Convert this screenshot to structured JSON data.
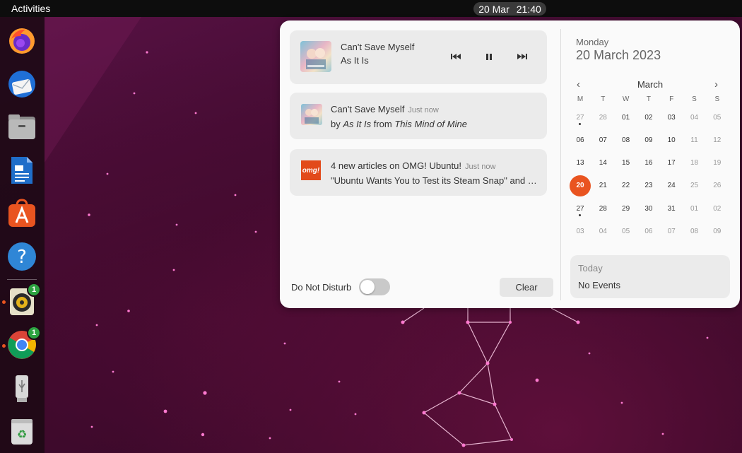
{
  "topbar": {
    "activities": "Activities",
    "clock_date": "20 Mar",
    "clock_time": "21:40"
  },
  "dock": {
    "items": [
      {
        "name": "firefox-icon"
      },
      {
        "name": "thunderbird-icon"
      },
      {
        "name": "files-icon"
      },
      {
        "name": "libreoffice-writer-icon"
      },
      {
        "name": "app-center-icon"
      },
      {
        "name": "help-icon",
        "glyph": "?"
      },
      {
        "name": "rhythmbox-icon",
        "badge": "1"
      },
      {
        "name": "chrome-icon",
        "badge": "1"
      },
      {
        "name": "usb-drive-icon"
      },
      {
        "name": "trash-icon",
        "glyph": "♻"
      }
    ]
  },
  "media": {
    "title": "Can't Save Myself",
    "artist": "As It Is",
    "controls": [
      "previous-icon",
      "pause-icon",
      "next-icon"
    ]
  },
  "notifications": [
    {
      "title": "Can't Save Myself",
      "time": "Just now",
      "body_by": "by",
      "body_artist": "As It Is",
      "body_from": "from",
      "body_album": "This Mind of Mine"
    },
    {
      "icon_label": "omg!",
      "title": "4 new articles on OMG! Ubuntu!",
      "time": "Just now",
      "body": "\"Ubuntu Wants You to Test its Steam Snap\" and …"
    }
  ],
  "dnd_label": "Do Not Disturb",
  "clear_label": "Clear",
  "calendar": {
    "day_name": "Monday",
    "full_date": "20 March 2023",
    "month": "March",
    "prev_glyph": "‹",
    "next_glyph": "›",
    "weekdays": [
      "M",
      "T",
      "W",
      "T",
      "F",
      "S",
      "S"
    ],
    "weeks": [
      [
        {
          "d": "27",
          "dim": true,
          "dot": true
        },
        {
          "d": "28",
          "dim": true
        },
        {
          "d": "01"
        },
        {
          "d": "02"
        },
        {
          "d": "03"
        },
        {
          "d": "04",
          "dim": true
        },
        {
          "d": "05",
          "dim": true
        }
      ],
      [
        {
          "d": "06"
        },
        {
          "d": "07"
        },
        {
          "d": "08"
        },
        {
          "d": "09"
        },
        {
          "d": "10"
        },
        {
          "d": "11",
          "dim": true
        },
        {
          "d": "12",
          "dim": true
        }
      ],
      [
        {
          "d": "13"
        },
        {
          "d": "14"
        },
        {
          "d": "15"
        },
        {
          "d": "16"
        },
        {
          "d": "17"
        },
        {
          "d": "18",
          "dim": true
        },
        {
          "d": "19",
          "dim": true
        }
      ],
      [
        {
          "d": "20",
          "today": true
        },
        {
          "d": "21"
        },
        {
          "d": "22"
        },
        {
          "d": "23"
        },
        {
          "d": "24"
        },
        {
          "d": "25",
          "dim": true
        },
        {
          "d": "26",
          "dim": true
        }
      ],
      [
        {
          "d": "27",
          "dot": true
        },
        {
          "d": "28"
        },
        {
          "d": "29"
        },
        {
          "d": "30"
        },
        {
          "d": "31"
        },
        {
          "d": "01",
          "dim": true
        },
        {
          "d": "02",
          "dim": true
        }
      ],
      [
        {
          "d": "03",
          "dim": true
        },
        {
          "d": "04",
          "dim": true
        },
        {
          "d": "05",
          "dim": true
        },
        {
          "d": "06",
          "dim": true
        },
        {
          "d": "07",
          "dim": true
        },
        {
          "d": "08",
          "dim": true
        },
        {
          "d": "09",
          "dim": true
        }
      ]
    ],
    "accent": "#e95420"
  },
  "events": {
    "title": "Today",
    "empty_text": "No Events"
  }
}
